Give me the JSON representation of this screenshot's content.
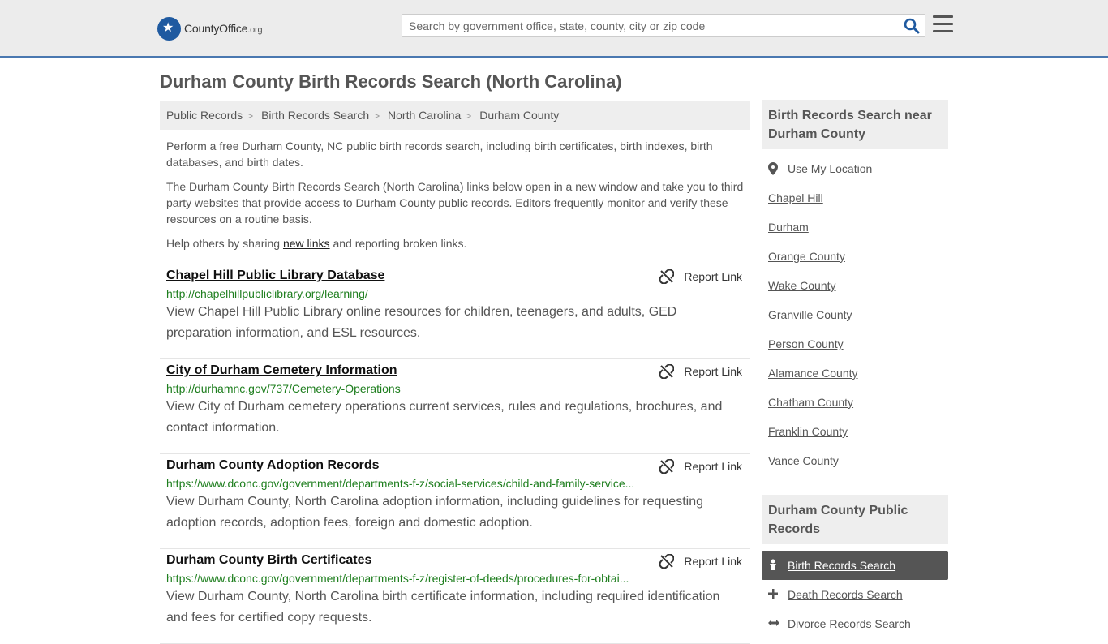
{
  "header": {
    "logo_text": "CountyOffice",
    "logo_tld": ".org",
    "search_placeholder": "Search by government office, state, county, city or zip code"
  },
  "page_title": "Durham County Birth Records Search (North Carolina)",
  "breadcrumb": [
    "Public Records",
    "Birth Records Search",
    "North Carolina",
    "Durham County"
  ],
  "intro": {
    "p1": "Perform a free Durham County, NC public birth records search, including birth certificates, birth indexes, birth databases, and birth dates.",
    "p2": "The Durham County Birth Records Search (North Carolina) links below open in a new window and take you to third party websites that provide access to Durham County public records. Editors frequently monitor and verify these resources on a routine basis.",
    "p3_before": "Help others by sharing ",
    "p3_link": "new links",
    "p3_after": " and reporting broken links."
  },
  "report_label": "Report Link",
  "results": [
    {
      "title": "Chapel Hill Public Library Database",
      "url": "http://chapelhillpubliclibrary.org/learning/",
      "desc": "View Chapel Hill Public Library online resources for children, teenagers, and adults, GED preparation information, and ESL resources."
    },
    {
      "title": "City of Durham Cemetery Information",
      "url": "http://durhamnc.gov/737/Cemetery-Operations",
      "desc": "View City of Durham cemetery operations current services, rules and regulations, brochures, and contact information."
    },
    {
      "title": "Durham County Adoption Records",
      "url": "https://www.dconc.gov/government/departments-f-z/social-services/child-and-family-service...",
      "desc": "View Durham County, North Carolina adoption information, including guidelines for requesting adoption records, adoption fees, foreign and domestic adoption."
    },
    {
      "title": "Durham County Birth Certificates",
      "url": "https://www.dconc.gov/government/departments-f-z/register-of-deeds/procedures-for-obtai...",
      "desc": "View Durham County, North Carolina birth certificate information, including required identification and fees for certified copy requests."
    }
  ],
  "sidebar": {
    "nearby_title": "Birth Records Search near Durham County",
    "use_location": "Use My Location",
    "nearby": [
      "Chapel Hill",
      "Durham",
      "Orange County",
      "Wake County",
      "Granville County",
      "Person County",
      "Alamance County",
      "Chatham County",
      "Franklin County",
      "Vance County"
    ],
    "public_title": "Durham County Public Records",
    "public_items": [
      {
        "label": "Birth Records Search",
        "icon": "baby-icon",
        "active": true
      },
      {
        "label": "Death Records Search",
        "icon": "cross-icon",
        "active": false
      },
      {
        "label": "Divorce Records Search",
        "icon": "arrows-icon",
        "active": false
      }
    ]
  }
}
